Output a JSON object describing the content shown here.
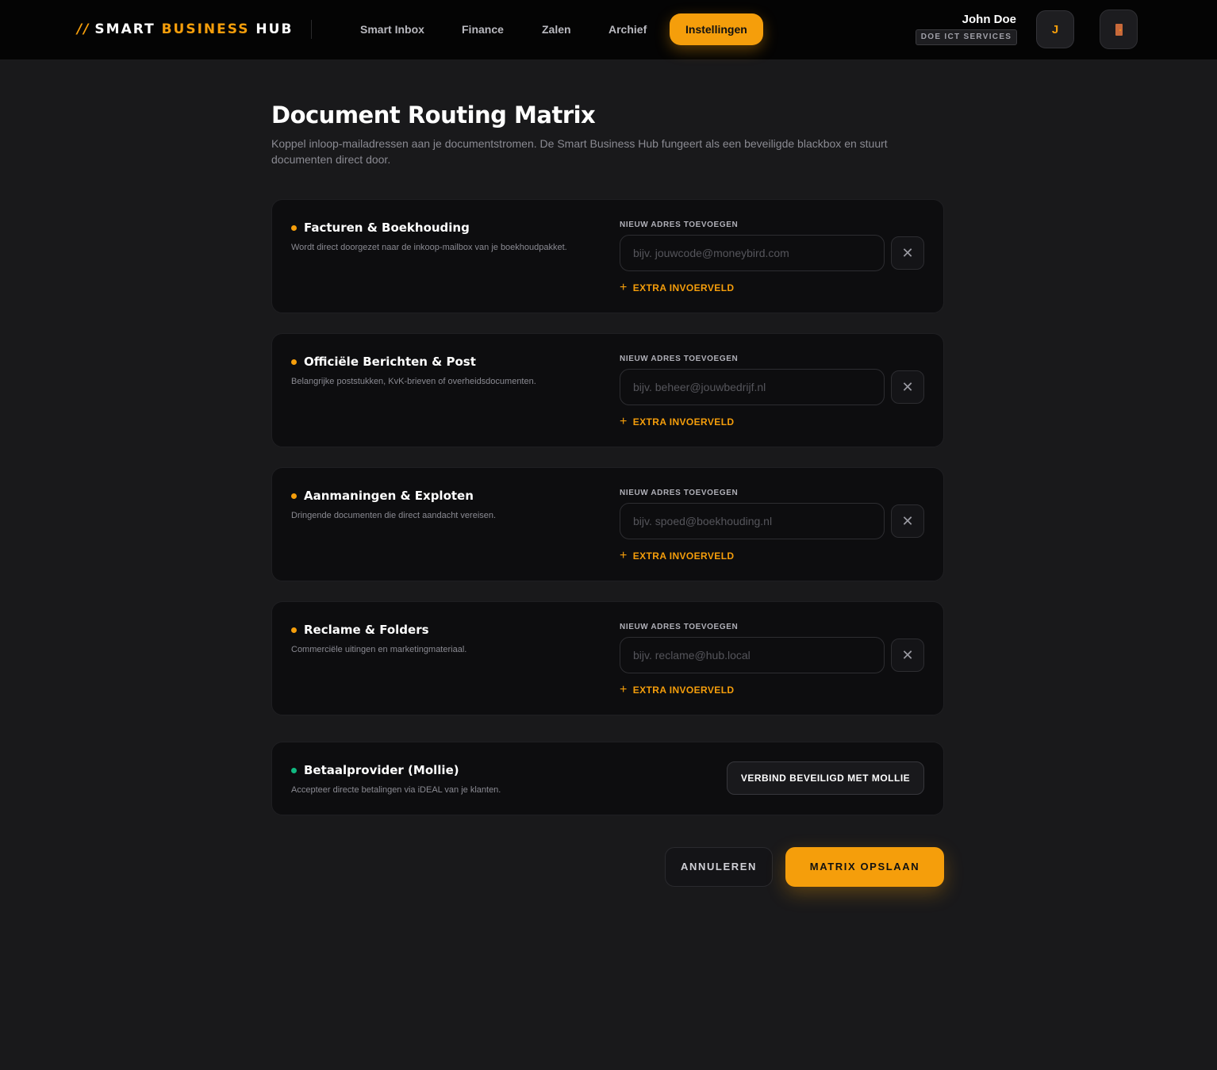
{
  "header": {
    "logo": {
      "prefix": "//",
      "part1": "SMART",
      "part2": "BUSINESS",
      "part3": "HUB"
    },
    "nav": [
      {
        "label": "Smart Inbox",
        "active": false
      },
      {
        "label": "Finance",
        "active": false
      },
      {
        "label": "Zalen",
        "active": false
      },
      {
        "label": "Archief",
        "active": false
      },
      {
        "label": "Instellingen",
        "active": true
      }
    ],
    "user": {
      "name": "John Doe",
      "company": "DOE ICT SERVICES",
      "avatar_initial": "J"
    },
    "logout_icon": "door-icon"
  },
  "page": {
    "title": "Document Routing Matrix",
    "subtitle": "Koppel inloop-mailadressen aan je documentstromen. De Smart Business Hub fungeert als een beveiligde blackbox en stuurt documenten direct door."
  },
  "routing_cards": [
    {
      "title": "Facturen & Boekhouding",
      "description": "Wordt direct doorgezet naar de inkoop-mailbox van je boekhoudpakket.",
      "field_label": "NIEUW ADRES TOEVOEGEN",
      "placeholder": "bijv. jouwcode@moneybird.com",
      "value": "",
      "remove_symbol": "✕",
      "add_label": "EXTRA INVOERVELD"
    },
    {
      "title": "Officiële Berichten & Post",
      "description": "Belangrijke poststukken, KvK-brieven of overheidsdocumenten.",
      "field_label": "NIEUW ADRES TOEVOEGEN",
      "placeholder": "bijv. beheer@jouwbedrijf.nl",
      "value": "",
      "remove_symbol": "✕",
      "add_label": "EXTRA INVOERVELD"
    },
    {
      "title": "Aanmaningen & Exploten",
      "description": "Dringende documenten die direct aandacht vereisen.",
      "field_label": "NIEUW ADRES TOEVOEGEN",
      "placeholder": "bijv. spoed@boekhouding.nl",
      "value": "",
      "remove_symbol": "✕",
      "add_label": "EXTRA INVOERVELD"
    },
    {
      "title": "Reclame & Folders",
      "description": "Commerciële uitingen en marketingmateriaal.",
      "field_label": "NIEUW ADRES TOEVOEGEN",
      "placeholder": "bijv. reclame@hub.local",
      "value": "",
      "remove_symbol": "✕",
      "add_label": "EXTRA INVOERVELD"
    }
  ],
  "payment_card": {
    "title": "Betaalprovider (Mollie)",
    "description": "Accepteer directe betalingen via iDEAL van je klanten.",
    "button_label": "VERBIND BEVEILIGD MET MOLLIE"
  },
  "actions": {
    "cancel_label": "ANNULEREN",
    "save_label": "MATRIX OPSLAAN"
  },
  "colors": {
    "accent": "#f59e0b",
    "status_green": "#10b981",
    "background": "#19191b",
    "card": "#0d0d0f"
  }
}
